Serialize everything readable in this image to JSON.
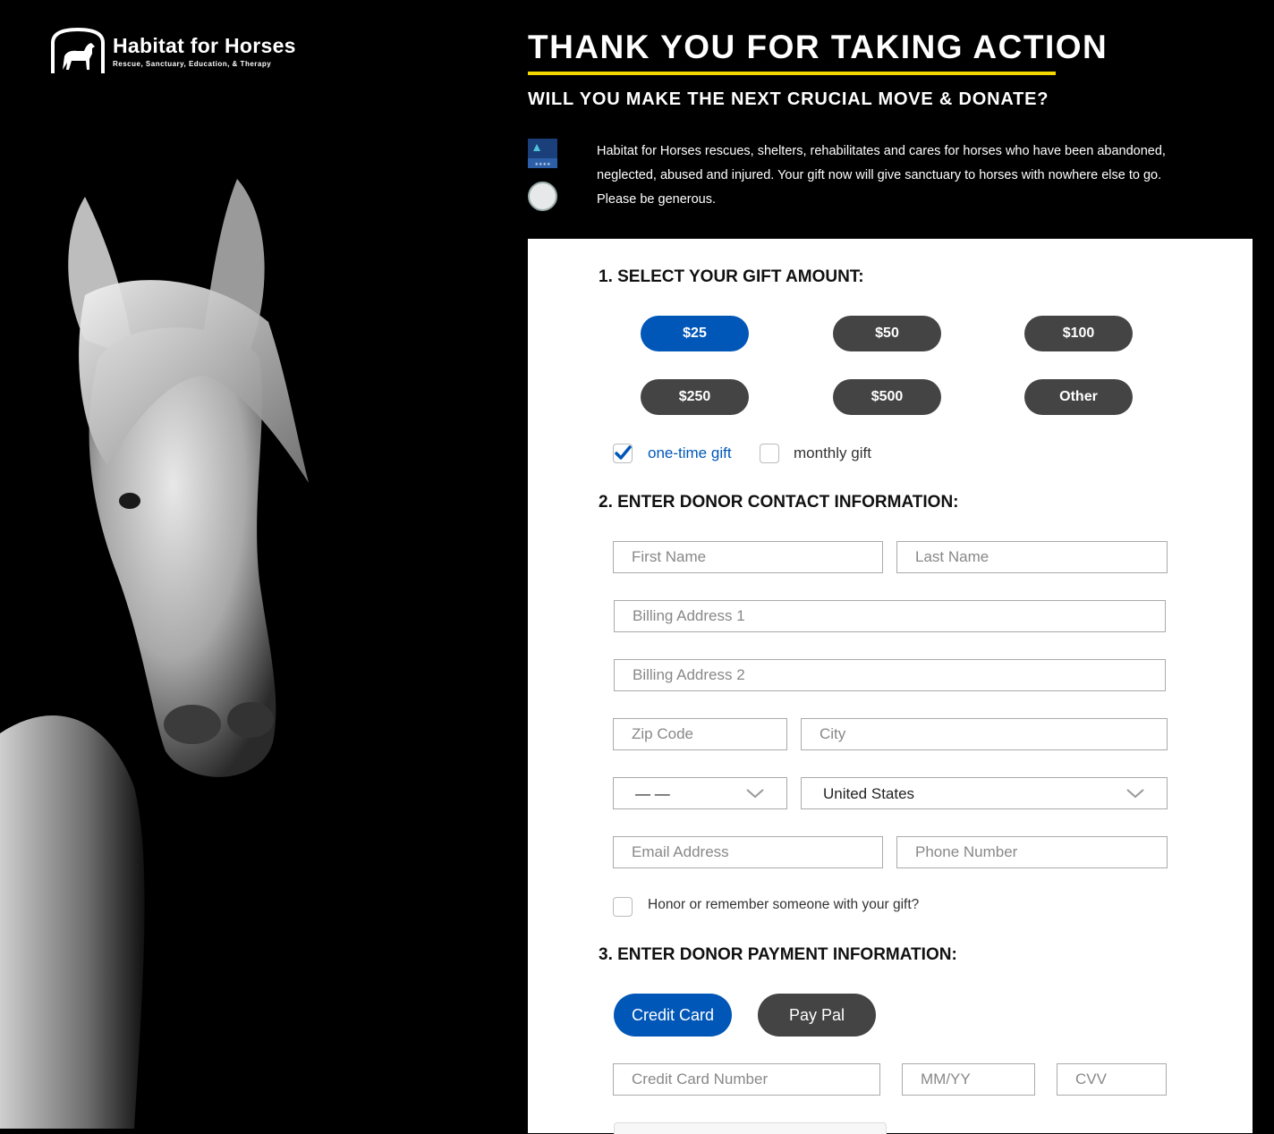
{
  "header": {
    "logo_name": "Habitat for Horses",
    "logo_tagline": "Rescue, Sanctuary, Education, & Therapy",
    "title": "THANK YOU FOR TAKING ACTION",
    "subtitle": "WILL YOU MAKE THE NEXT CRUCIAL MOVE & DONATE?",
    "intro": "Habitat for Horses rescues, shelters, rehabilitates and cares for horses who have been abandoned, neglected, abused and injured. Your gift now will give sanctuary to horses with nowhere else to go. Please be generous."
  },
  "colors": {
    "accent": "#0057b8",
    "dark_button": "#444444",
    "title_underline": "#f5d800",
    "background": "#000000"
  },
  "gift": {
    "heading": "1.  SELECT YOUR GIFT AMOUNT:",
    "amounts": [
      "$25",
      "$50",
      "$100",
      "$250",
      "$500",
      "Other"
    ],
    "selected": "$25",
    "one_time_label": "one-time gift",
    "monthly_label": "monthly gift",
    "one_time_checked": true,
    "monthly_checked": false
  },
  "contact": {
    "heading": "2.  ENTER DONOR CONTACT INFORMATION:",
    "first_name": "First Name",
    "last_name": "Last Name",
    "address1": "Billing Address 1",
    "address2": "Billing Address 2",
    "zip": "Zip Code",
    "city": "City",
    "state_value": "— —",
    "country_value": "United States",
    "email": "Email Address",
    "phone": "Phone Number",
    "honor_label": "Honor or remember someone with your gift?"
  },
  "payment": {
    "heading": "3.  ENTER DONOR PAYMENT INFORMATION:",
    "credit_card_label": "Credit Card",
    "paypal_label": "Pay Pal",
    "card_number": "Credit Card Number",
    "expiry": "MM/YY",
    "cvv": "CVV"
  }
}
